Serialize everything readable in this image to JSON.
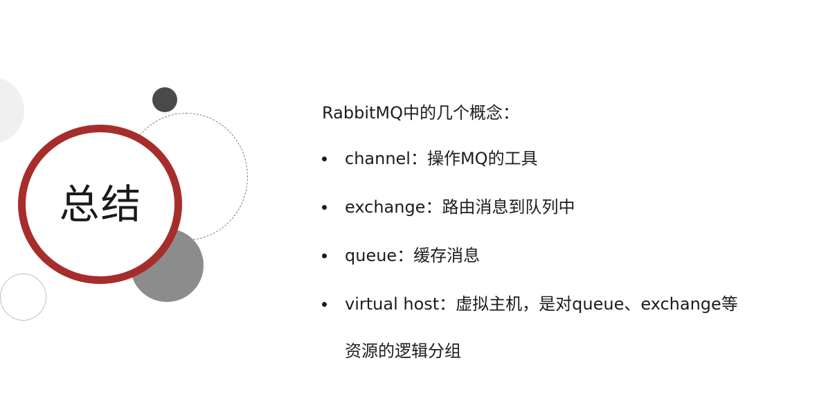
{
  "slide": {
    "title": "总结",
    "heading": "RabbitMQ中的几个概念：",
    "bullets": [
      {
        "text": "channel：操作MQ的工具"
      },
      {
        "text": "exchange：路由消息到队列中"
      },
      {
        "text": "queue：缓存消息"
      },
      {
        "text": "virtual host：虚拟主机，是对queue、exchange等"
      }
    ],
    "continuation": "资源的逻辑分组"
  },
  "colors": {
    "ring_red": "#a72d2c",
    "dark_dot": "#4a4a4a",
    "gray_disc": "#8c8c8c",
    "text": "#1c1c1c"
  }
}
